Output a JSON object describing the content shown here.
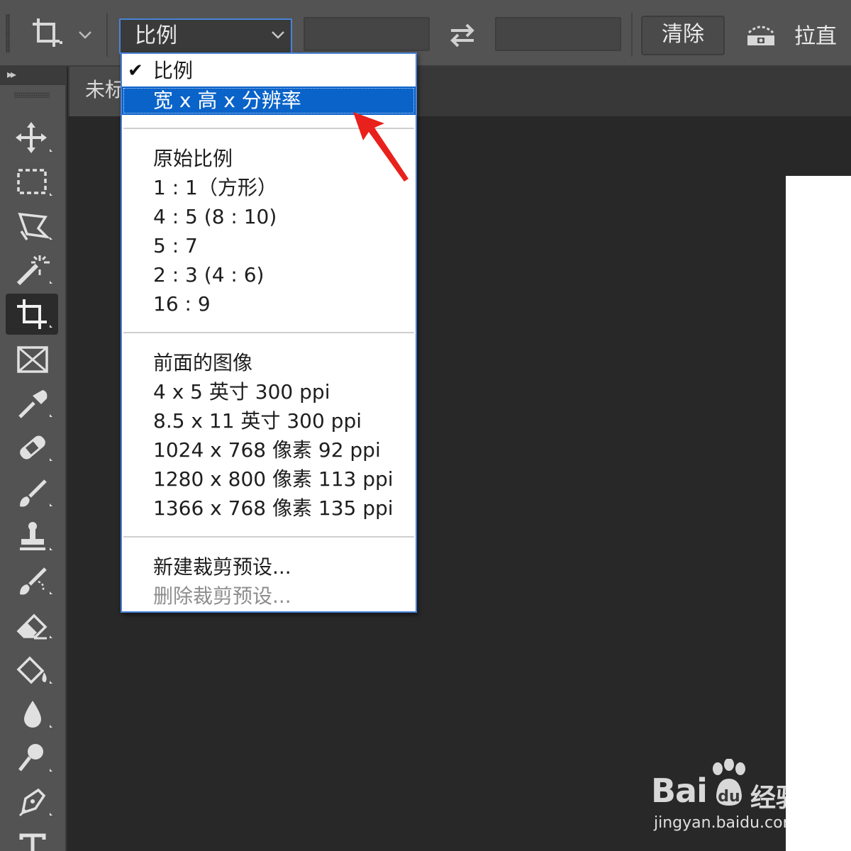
{
  "options_bar": {
    "ratio_select_value": "比例",
    "clear_label": "清除",
    "straighten_label": "拉直"
  },
  "document": {
    "tab_title": "未标"
  },
  "ratio_menu": {
    "items": [
      {
        "label": "比例",
        "checked": true
      },
      {
        "label": "宽 x 高 x 分辨率",
        "selected": true
      },
      {
        "label": "原始比例"
      },
      {
        "label": "1 : 1（方形）"
      },
      {
        "label": "4 : 5 (8 : 10)"
      },
      {
        "label": "5 : 7"
      },
      {
        "label": "2 : 3 (4 : 6)"
      },
      {
        "label": "16 : 9"
      },
      {
        "label": "前面的图像"
      },
      {
        "label": "4 x 5 英寸 300 ppi"
      },
      {
        "label": "8.5 x 11 英寸 300 ppi"
      },
      {
        "label": "1024 x 768 像素 92 ppi"
      },
      {
        "label": "1280 x 800 像素 113 ppi"
      },
      {
        "label": "1366 x 768 像素 135 ppi"
      },
      {
        "label": "新建裁剪预设..."
      },
      {
        "label": "删除裁剪预设...",
        "disabled": true
      }
    ]
  },
  "toolbar": {
    "tools": [
      "move-icon",
      "rectangular-marquee-icon",
      "polygonal-lasso-icon",
      "magic-wand-icon",
      "crop-icon",
      "frame-icon",
      "eyedropper-icon",
      "healing-brush-icon",
      "brush-icon",
      "clone-stamp-icon",
      "history-brush-icon",
      "eraser-icon",
      "paint-bucket-icon",
      "blur-icon",
      "dodge-icon",
      "pen-icon",
      "type-icon"
    ]
  },
  "watermark": {
    "logo": "Bai",
    "logo_cn": "经验",
    "url": "jingyan.baidu.com"
  },
  "colors": {
    "selection": "#0a63c9",
    "focus_border": "#4a84d8",
    "arrow": "#e8211c"
  }
}
